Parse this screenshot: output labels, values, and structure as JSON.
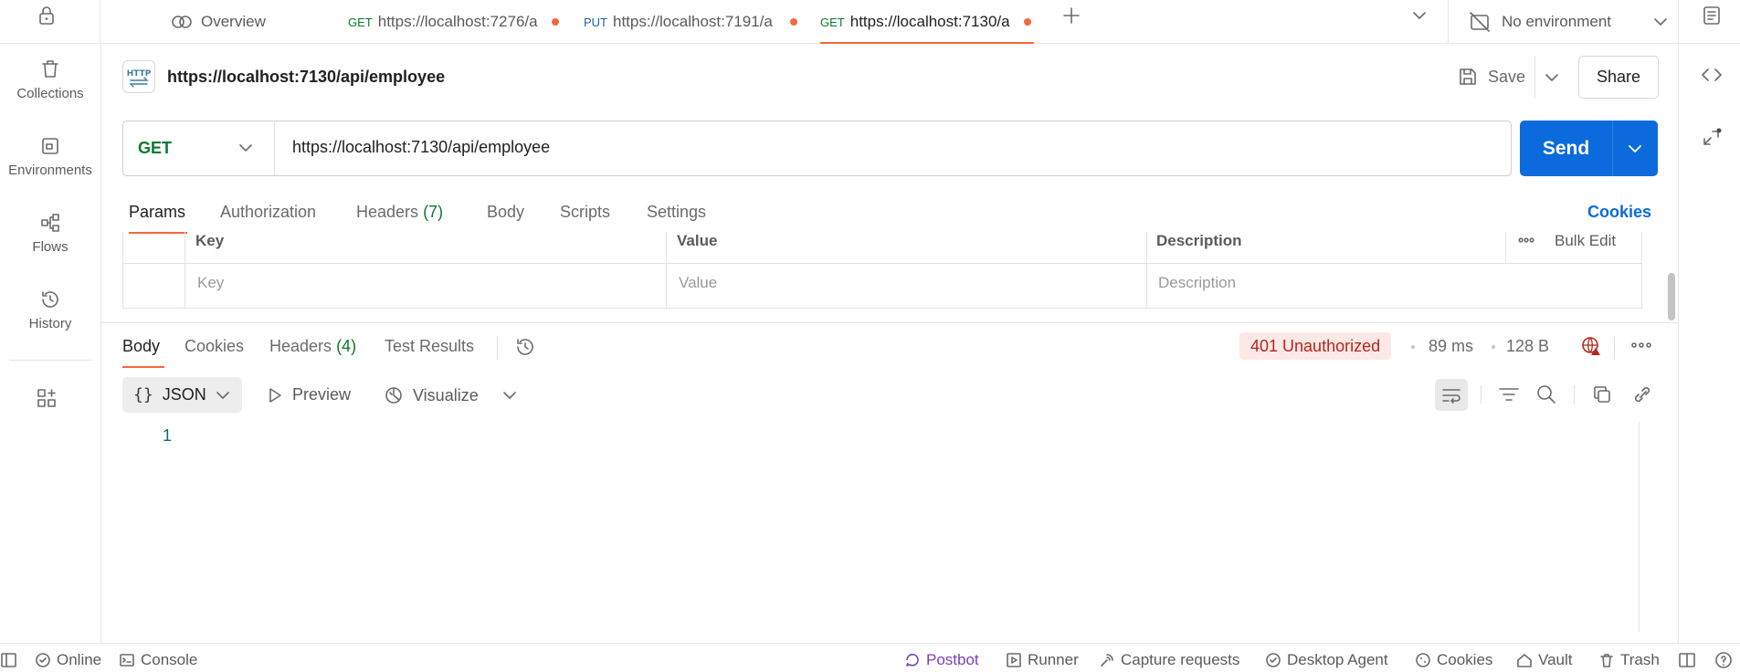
{
  "tabs": [
    {
      "method": "",
      "label": "Overview"
    },
    {
      "method": "GET",
      "label": "https://localhost:7276/a",
      "unsaved": true
    },
    {
      "method": "PUT",
      "label": "https://localhost:7191/a",
      "unsaved": true
    },
    {
      "method": "GET",
      "label": "https://localhost:7130/a",
      "unsaved": true,
      "active": true
    }
  ],
  "environment": {
    "label": "No environment"
  },
  "sidebar": {
    "items": [
      {
        "label": "Collections",
        "icon": "trash-can-icon"
      },
      {
        "label": "Environments",
        "icon": "environment-icon"
      },
      {
        "label": "Flows",
        "icon": "flows-icon"
      },
      {
        "label": "History",
        "icon": "history-icon"
      }
    ]
  },
  "request": {
    "title": "https://localhost:7130/api/employee",
    "save_label": "Save",
    "share_label": "Share",
    "method": "GET",
    "url": "https://localhost:7130/api/employee",
    "send_label": "Send",
    "tabs": [
      {
        "label": "Params"
      },
      {
        "label": "Authorization"
      },
      {
        "label": "Headers",
        "count": "(7)"
      },
      {
        "label": "Body"
      },
      {
        "label": "Scripts"
      },
      {
        "label": "Settings"
      }
    ],
    "cookies_link": "Cookies",
    "params": {
      "headers": [
        "Key",
        "Value",
        "Description"
      ],
      "bulk_edit": "Bulk Edit",
      "placeholders": [
        "Key",
        "Value",
        "Description"
      ]
    }
  },
  "response": {
    "tabs": [
      {
        "label": "Body"
      },
      {
        "label": "Cookies"
      },
      {
        "label": "Headers",
        "count": "(4)"
      },
      {
        "label": "Test Results"
      }
    ],
    "status": "401 Unauthorized",
    "time": "89 ms",
    "size": "128 B",
    "format": "JSON",
    "preview_label": "Preview",
    "visualize_label": "Visualize",
    "line_number": "1"
  },
  "statusbar": {
    "online": "Online",
    "console": "Console",
    "postbot": "Postbot",
    "runner": "Runner",
    "capture": "Capture requests",
    "agent": "Desktop Agent",
    "cookies": "Cookies",
    "vault": "Vault",
    "trash": "Trash"
  },
  "colors": {
    "accent": "#f2683c",
    "send": "#0b6bdc",
    "get": "#0b7a2a",
    "put": "#1f5fb8",
    "status_error": "#b3261e"
  }
}
